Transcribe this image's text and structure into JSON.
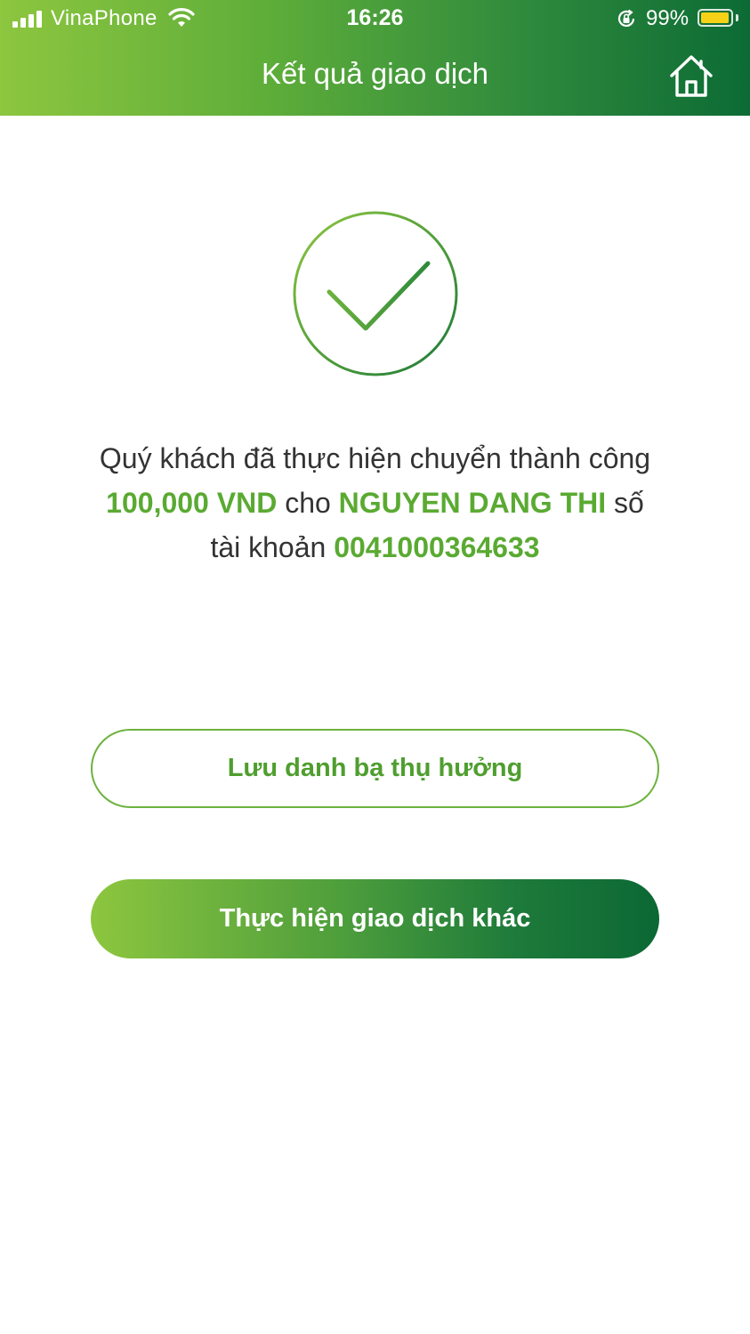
{
  "status_bar": {
    "carrier": "VinaPhone",
    "time": "16:26",
    "battery_percent": "99%",
    "icons": [
      "signal-icon",
      "wifi-icon",
      "rotation-lock-icon",
      "battery-icon"
    ]
  },
  "header": {
    "title": "Kết quả giao dịch",
    "home_icon": "home-icon"
  },
  "result": {
    "status_icon": "checkmark-circle-icon",
    "message_prefix": "Quý khách đã thực hiện chuyển thành công",
    "amount": "100,000 VND",
    "connector_1": "cho",
    "recipient_name": "NGUYEN DANG THI",
    "connector_2": "số",
    "connector_3": "tài khoản",
    "account_number": "0041000364633"
  },
  "actions": {
    "save_beneficiary_label": "Lưu danh bạ thụ hưởng",
    "new_transaction_label": "Thực hiện giao dịch khác"
  },
  "colors": {
    "brand_green_light": "#8dc63f",
    "brand_green_dark": "#0c6b35",
    "highlight_text": "#5aaa32",
    "body_text": "#333333",
    "battery_fill": "#f7d117"
  }
}
